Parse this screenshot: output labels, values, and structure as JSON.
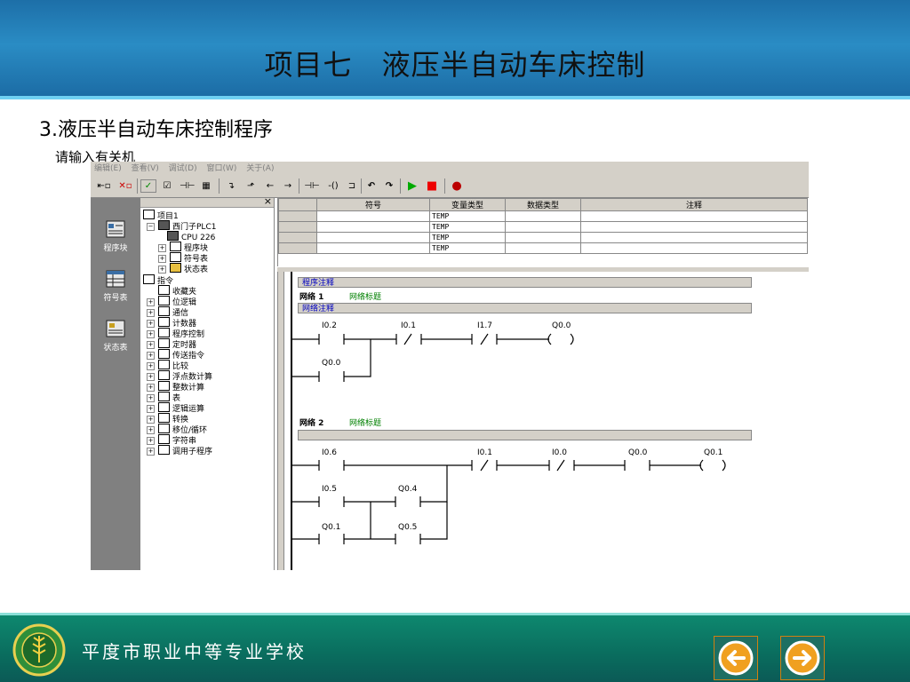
{
  "slide": {
    "title": "项目七　液压半自动车床控制",
    "section": "3.液压半自动车床控制程序",
    "caption": "请输入有关机",
    "footer_school": "平度市职业中等专业学校"
  },
  "app": {
    "menu": [
      "编辑(E)",
      "查看(V)",
      "调试(D)",
      "窗口(W)",
      "关于(A)"
    ],
    "toolbar_icons": [
      "upload-icon",
      "download-icon",
      "compile-icon",
      "compile-all-icon",
      "network-icon",
      "table-icon",
      "line-down-icon",
      "line-up-icon",
      "line-left-icon",
      "line-right-icon",
      "contact-icon",
      "coil-icon",
      "box-icon",
      "undo-icon",
      "redo-icon",
      "run-icon",
      "stop-icon",
      "record-icon"
    ],
    "nav_items": [
      {
        "label": "程序块",
        "icon": "program-block-icon"
      },
      {
        "label": "符号表",
        "icon": "symbol-table-icon"
      },
      {
        "label": "状态表",
        "icon": "status-table-icon"
      }
    ],
    "tree": [
      {
        "label": "项目1",
        "level": 0
      },
      {
        "label": "西门子PLC1",
        "level": 1,
        "pm": "−"
      },
      {
        "label": "CPU 226",
        "level": 2
      },
      {
        "label": "程序块",
        "level": 2,
        "pm": "+"
      },
      {
        "label": "符号表",
        "level": 2,
        "pm": "+"
      },
      {
        "label": "状态表",
        "level": 2,
        "pm": "+"
      },
      {
        "label": "指令",
        "level": 0
      },
      {
        "label": "收藏夹",
        "level": 1
      },
      {
        "label": "位逻辑",
        "level": 1,
        "pm": "+"
      },
      {
        "label": "通信",
        "level": 1,
        "pm": "+"
      },
      {
        "label": "计数器",
        "level": 1,
        "pm": "+"
      },
      {
        "label": "程序控制",
        "level": 1,
        "pm": "+"
      },
      {
        "label": "定时器",
        "level": 1,
        "pm": "+"
      },
      {
        "label": "传送指令",
        "level": 1,
        "pm": "+"
      },
      {
        "label": "比较",
        "level": 1,
        "pm": "+"
      },
      {
        "label": "浮点数计算",
        "level": 1,
        "pm": "+"
      },
      {
        "label": "整数计算",
        "level": 1,
        "pm": "+"
      },
      {
        "label": "表",
        "level": 1,
        "pm": "+"
      },
      {
        "label": "逻辑运算",
        "level": 1,
        "pm": "+"
      },
      {
        "label": "转换",
        "level": 1,
        "pm": "+"
      },
      {
        "label": "移位/循环",
        "level": 1,
        "pm": "+"
      },
      {
        "label": "字符串",
        "level": 1,
        "pm": "+"
      },
      {
        "label": "调用子程序",
        "level": 1,
        "pm": "+"
      }
    ],
    "var_table": {
      "headers": [
        "符号",
        "变量类型",
        "数据类型",
        "注释"
      ],
      "rows": [
        [
          "",
          "TEMP",
          "",
          ""
        ],
        [
          "",
          "TEMP",
          "",
          ""
        ],
        [
          "",
          "TEMP",
          "",
          ""
        ],
        [
          "",
          "TEMP",
          "",
          ""
        ]
      ]
    },
    "editor": {
      "program_comment": "程序注释",
      "network_comment": "网络注释",
      "networks": [
        {
          "label": "网络 1",
          "title": "网络标题",
          "contacts": [
            "I0.2",
            "I0.1",
            "I1.7",
            "Q0.0"
          ],
          "branch": [
            "Q0.0"
          ]
        },
        {
          "label": "网络 2",
          "title": "网络标题",
          "contacts": [
            "I0.6",
            "I0.1",
            "I0.0",
            "Q0.0",
            "Q0.1"
          ],
          "branch": [
            "I0.5",
            "Q0.4",
            "Q0.1",
            "Q0.5"
          ]
        }
      ]
    }
  }
}
